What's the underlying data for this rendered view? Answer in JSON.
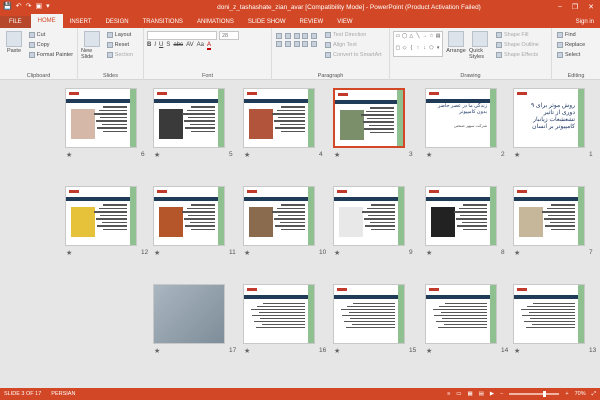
{
  "window": {
    "title": "doni_z_tashashate_zian_avar [Compatibility Mode] - PowerPoint (Product Activation Failed)",
    "minimize": "–",
    "restore": "❐",
    "close": "✕"
  },
  "qat": {
    "save": "💾",
    "undo": "↶",
    "redo": "↷",
    "start": "▣",
    "customize": "▾"
  },
  "tabs": [
    {
      "label": "FILE"
    },
    {
      "label": "HOME"
    },
    {
      "label": "INSERT"
    },
    {
      "label": "DESIGN"
    },
    {
      "label": "TRANSITIONS"
    },
    {
      "label": "ANIMATIONS"
    },
    {
      "label": "SLIDE SHOW"
    },
    {
      "label": "REVIEW"
    },
    {
      "label": "VIEW"
    }
  ],
  "signin": "Sign in",
  "ribbon": {
    "clipboard": {
      "label": "Clipboard",
      "paste": "Paste",
      "cut": "Cut",
      "copy": "Copy",
      "format_painter": "Format Painter"
    },
    "slides": {
      "label": "Slides",
      "new_slide": "New Slide",
      "layout": "Layout",
      "reset": "Reset",
      "section": "Section"
    },
    "font": {
      "label": "Font",
      "size": "28",
      "bold": "B",
      "italic": "I",
      "underline": "U",
      "shadow": "S",
      "strike": "abc",
      "spacing": "AV",
      "case": "Aa",
      "color": "A"
    },
    "paragraph": {
      "label": "Paragraph",
      "text_direction": "Text Direction",
      "align_text": "Align Text",
      "convert_smartart": "Convert to SmartArt"
    },
    "drawing": {
      "label": "Drawing",
      "arrange": "Arrange",
      "quick_styles": "Quick Styles",
      "shape_fill": "Shape Fill",
      "shape_outline": "Shape Outline",
      "shape_effects": "Shape Effects"
    },
    "editing": {
      "label": "Editing",
      "find": "Find",
      "replace": "Replace",
      "select": "Select"
    }
  },
  "slides": [
    {
      "num": "1",
      "headline": "۹ روش موثر برای دوری از تاثیر تشعشعات زیانبار کامپیوتر بر انسان",
      "kind": "title"
    },
    {
      "num": "2",
      "headline": "زندگی ما در عصر حاضر بدون کامپیوتر",
      "sub": "شرکت سپهر صنعتی",
      "kind": "text"
    },
    {
      "num": "3",
      "kind": "pic",
      "pic": "#7a8f6a"
    },
    {
      "num": "4",
      "kind": "pic",
      "pic": "#b2543c"
    },
    {
      "num": "5",
      "kind": "pic",
      "pic": "#3a3a3a"
    },
    {
      "num": "6",
      "kind": "pic",
      "pic": "#d6b8a8"
    },
    {
      "num": "7",
      "kind": "pic",
      "pic": "#c7b79a"
    },
    {
      "num": "8",
      "kind": "pic",
      "pic": "#222222"
    },
    {
      "num": "9",
      "kind": "pic",
      "pic": "#e8e8e8"
    },
    {
      "num": "10",
      "kind": "pic",
      "pic": "#8a6b4d"
    },
    {
      "num": "11",
      "kind": "pic",
      "pic": "#b5562a"
    },
    {
      "num": "12",
      "kind": "pic",
      "pic": "#e6c13a"
    },
    {
      "num": "13",
      "kind": "body"
    },
    {
      "num": "14",
      "kind": "body"
    },
    {
      "num": "15",
      "kind": "body"
    },
    {
      "num": "16",
      "kind": "body"
    },
    {
      "num": "17",
      "kind": "photo",
      "pic": "#7c8c98"
    }
  ],
  "status": {
    "slide": "SLIDE 3 OF 17",
    "language": "PERSIAN",
    "zoom": "70%"
  },
  "accent": "#d24726"
}
